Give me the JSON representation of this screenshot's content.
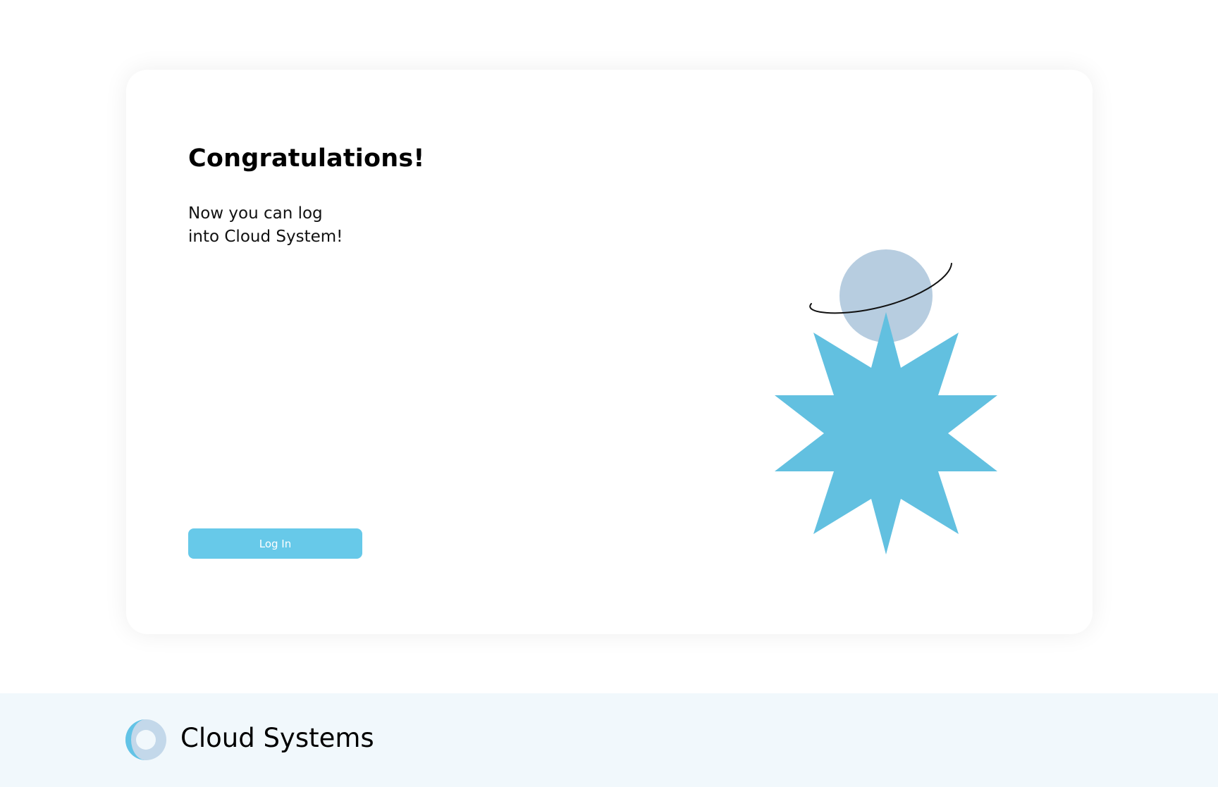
{
  "card": {
    "title": "Congratulations!",
    "message_line1": "Now you can log",
    "message_line2": "into Cloud System!",
    "login_button_label": "Log In"
  },
  "illustration": {
    "icons": [
      "planet-icon",
      "orbit-ring-icon",
      "star-burst-icon"
    ],
    "colors": {
      "planet": "#b7cde0",
      "star": "#62c0e0",
      "orbit": "#111111"
    }
  },
  "footer": {
    "brand_name": "Cloud Systems",
    "logo_icon": "cloud-systems-logo-icon",
    "colors": {
      "background": "#f1f8fc",
      "logo_primary": "#62c3e6",
      "logo_secondary": "#c3d8ea"
    }
  },
  "colors": {
    "accent": "#67c9e9",
    "text": "#000000"
  }
}
